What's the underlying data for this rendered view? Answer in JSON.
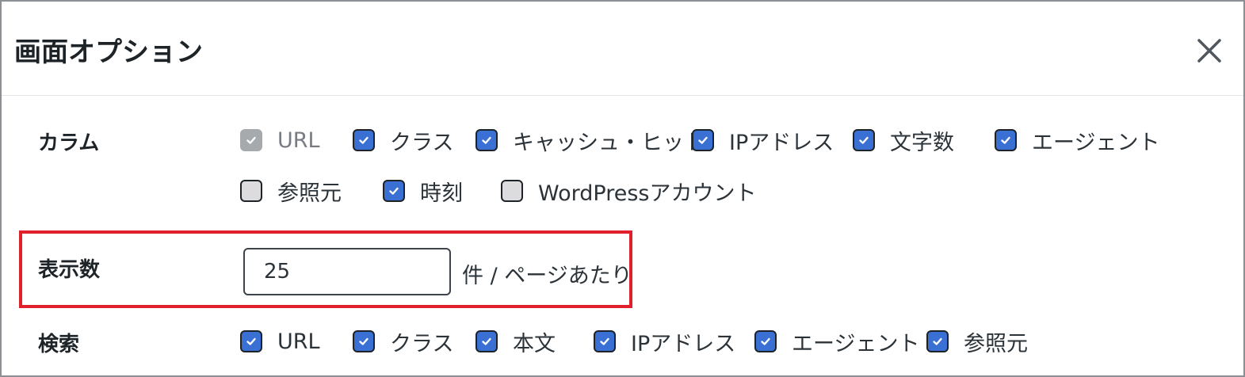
{
  "dialog": {
    "title": "画面オプション",
    "close_icon": "close-icon"
  },
  "columns": {
    "label": "カラム",
    "options": [
      {
        "label": "URL",
        "state": "disabled-checked"
      },
      {
        "label": "クラス",
        "state": "checked"
      },
      {
        "label": "キャッシュ・ヒット",
        "state": "checked"
      },
      {
        "label": "IPアドレス",
        "state": "checked"
      },
      {
        "label": "文字数",
        "state": "checked"
      },
      {
        "label": "エージェント",
        "state": "checked"
      },
      {
        "label": "参照元",
        "state": "unchecked"
      },
      {
        "label": "時刻",
        "state": "checked"
      },
      {
        "label": "WordPressアカウント",
        "state": "unchecked"
      }
    ]
  },
  "pagination": {
    "label": "表示数",
    "value": "25",
    "suffix": "件 / ページあたり"
  },
  "search": {
    "label": "検索",
    "options": [
      {
        "label": "URL",
        "state": "checked"
      },
      {
        "label": "クラス",
        "state": "checked"
      },
      {
        "label": "本文",
        "state": "checked"
      },
      {
        "label": "IPアドレス",
        "state": "checked"
      },
      {
        "label": "エージェント",
        "state": "checked"
      },
      {
        "label": "参照元",
        "state": "checked"
      }
    ]
  },
  "colors": {
    "checkbox_checked": "#3a6fd4",
    "checkbox_unchecked": "#dcdcde",
    "checkbox_disabled": "#a7aaad",
    "highlight_border": "#e0202a"
  }
}
